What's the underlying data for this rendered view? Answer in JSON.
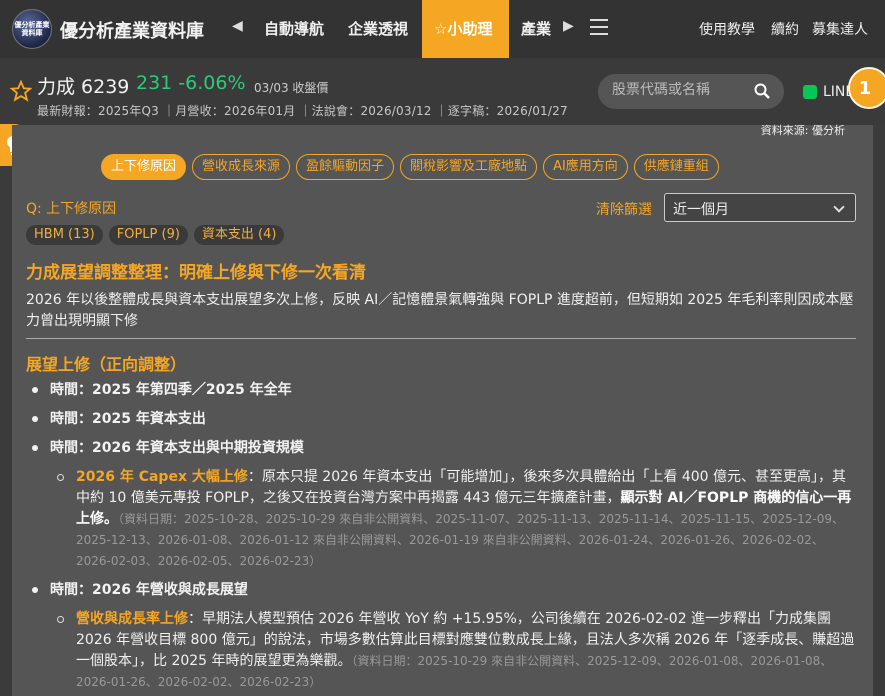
{
  "topnav": {
    "logo_text": "優分析產業資料庫",
    "brand": "優分析產業資料庫",
    "nav_items": [
      "自動導航",
      "企業透視",
      "☆小助理",
      "產業"
    ],
    "right_links": [
      "使用教學",
      "續約",
      "募集達人"
    ]
  },
  "stock": {
    "name": "力成 6239",
    "price_change": "231 -6.06%",
    "date": "03/03 收盤價",
    "meta": "最新財報：2025年Q3 ｜月營收：2026年01月 ｜法說會：2026/03/12 ｜逐字稿：2026/01/27",
    "search_placeholder": "股票代碼或名稱",
    "line_label": "LINE",
    "help_count": "1"
  },
  "panel": {
    "source": "資料來源: 優分析",
    "chips": [
      "上下修原因",
      "營收成長來源",
      "盈餘驅動因子",
      "關稅影響及工廠地點",
      "AI應用方向",
      "供應鏈重組"
    ],
    "question": "Q: 上下修原因",
    "clear_filter": "清除篩選",
    "period": "近一個月",
    "tags": [
      "HBM (13)",
      "FOPLP (9)",
      "資本支出 (4)"
    ],
    "headline": "力成展望調整整理：明確上修與下修一次看清",
    "summary": "2026 年以後整體成長與資本支出展望多次上修，反映 AI／記憶體景氣轉強與 FOPLP 進度超前，但短期如 2025 年毛利率則因成本壓力曾出現明顯下修",
    "section_title": "展望上修（正向調整）",
    "items": [
      "時間：2025 年第四季／2025 年全年",
      "時間：2025 年資本支出",
      "時間：2026 年資本支出與中期投資規模"
    ],
    "sub1": {
      "lead": "2026 年 Capex 大幅上修",
      "body": "：原本只提 2026 年資本支出「可能增加」，後來多次具體給出「上看 400 億元、甚至更高」，其中約 10 億美元專投 FOPLP，之後又在投資台灣方案中再揭露 443 億元三年擴產計畫，",
      "bold": "顯示對 AI／FOPLP 商機的信心一再上修。",
      "dates": "（資料日期：2025-10-28、2025-10-29 來自非公開資料、2025-11-07、2025-11-13、2025-11-14、2025-11-15、2025-12-09、2025-12-13、2026-01-08、2026-01-12 來自非公開資料、2026-01-19 來自非公開資料、2026-01-24、2026-01-26、2026-02-02、2026-02-03、2026-02-05、2026-02-23）"
    },
    "item4": "時間：2026 年營收與成長展望",
    "sub2": {
      "lead": "營收與成長率上修",
      "body": "：早期法人模型預估 2026 年營收 YoY 約 +15.95%，公司後續在 2026-02-02 進一步釋出「力成集團 2026 年營收目標 800 億元」的說法，市場多數估算此目標對應雙位數成長上緣，且法人多次稱 2026 年「逐季成長、賺超過一個股本」，比 2025 年時的展望更為樂觀。",
      "dates": "（資料日期：2025-10-29 來自非公開資料、2025-12-09、2026-01-08、2026-01-08、2026-01-26、2026-02-02、2026-02-23）"
    }
  }
}
